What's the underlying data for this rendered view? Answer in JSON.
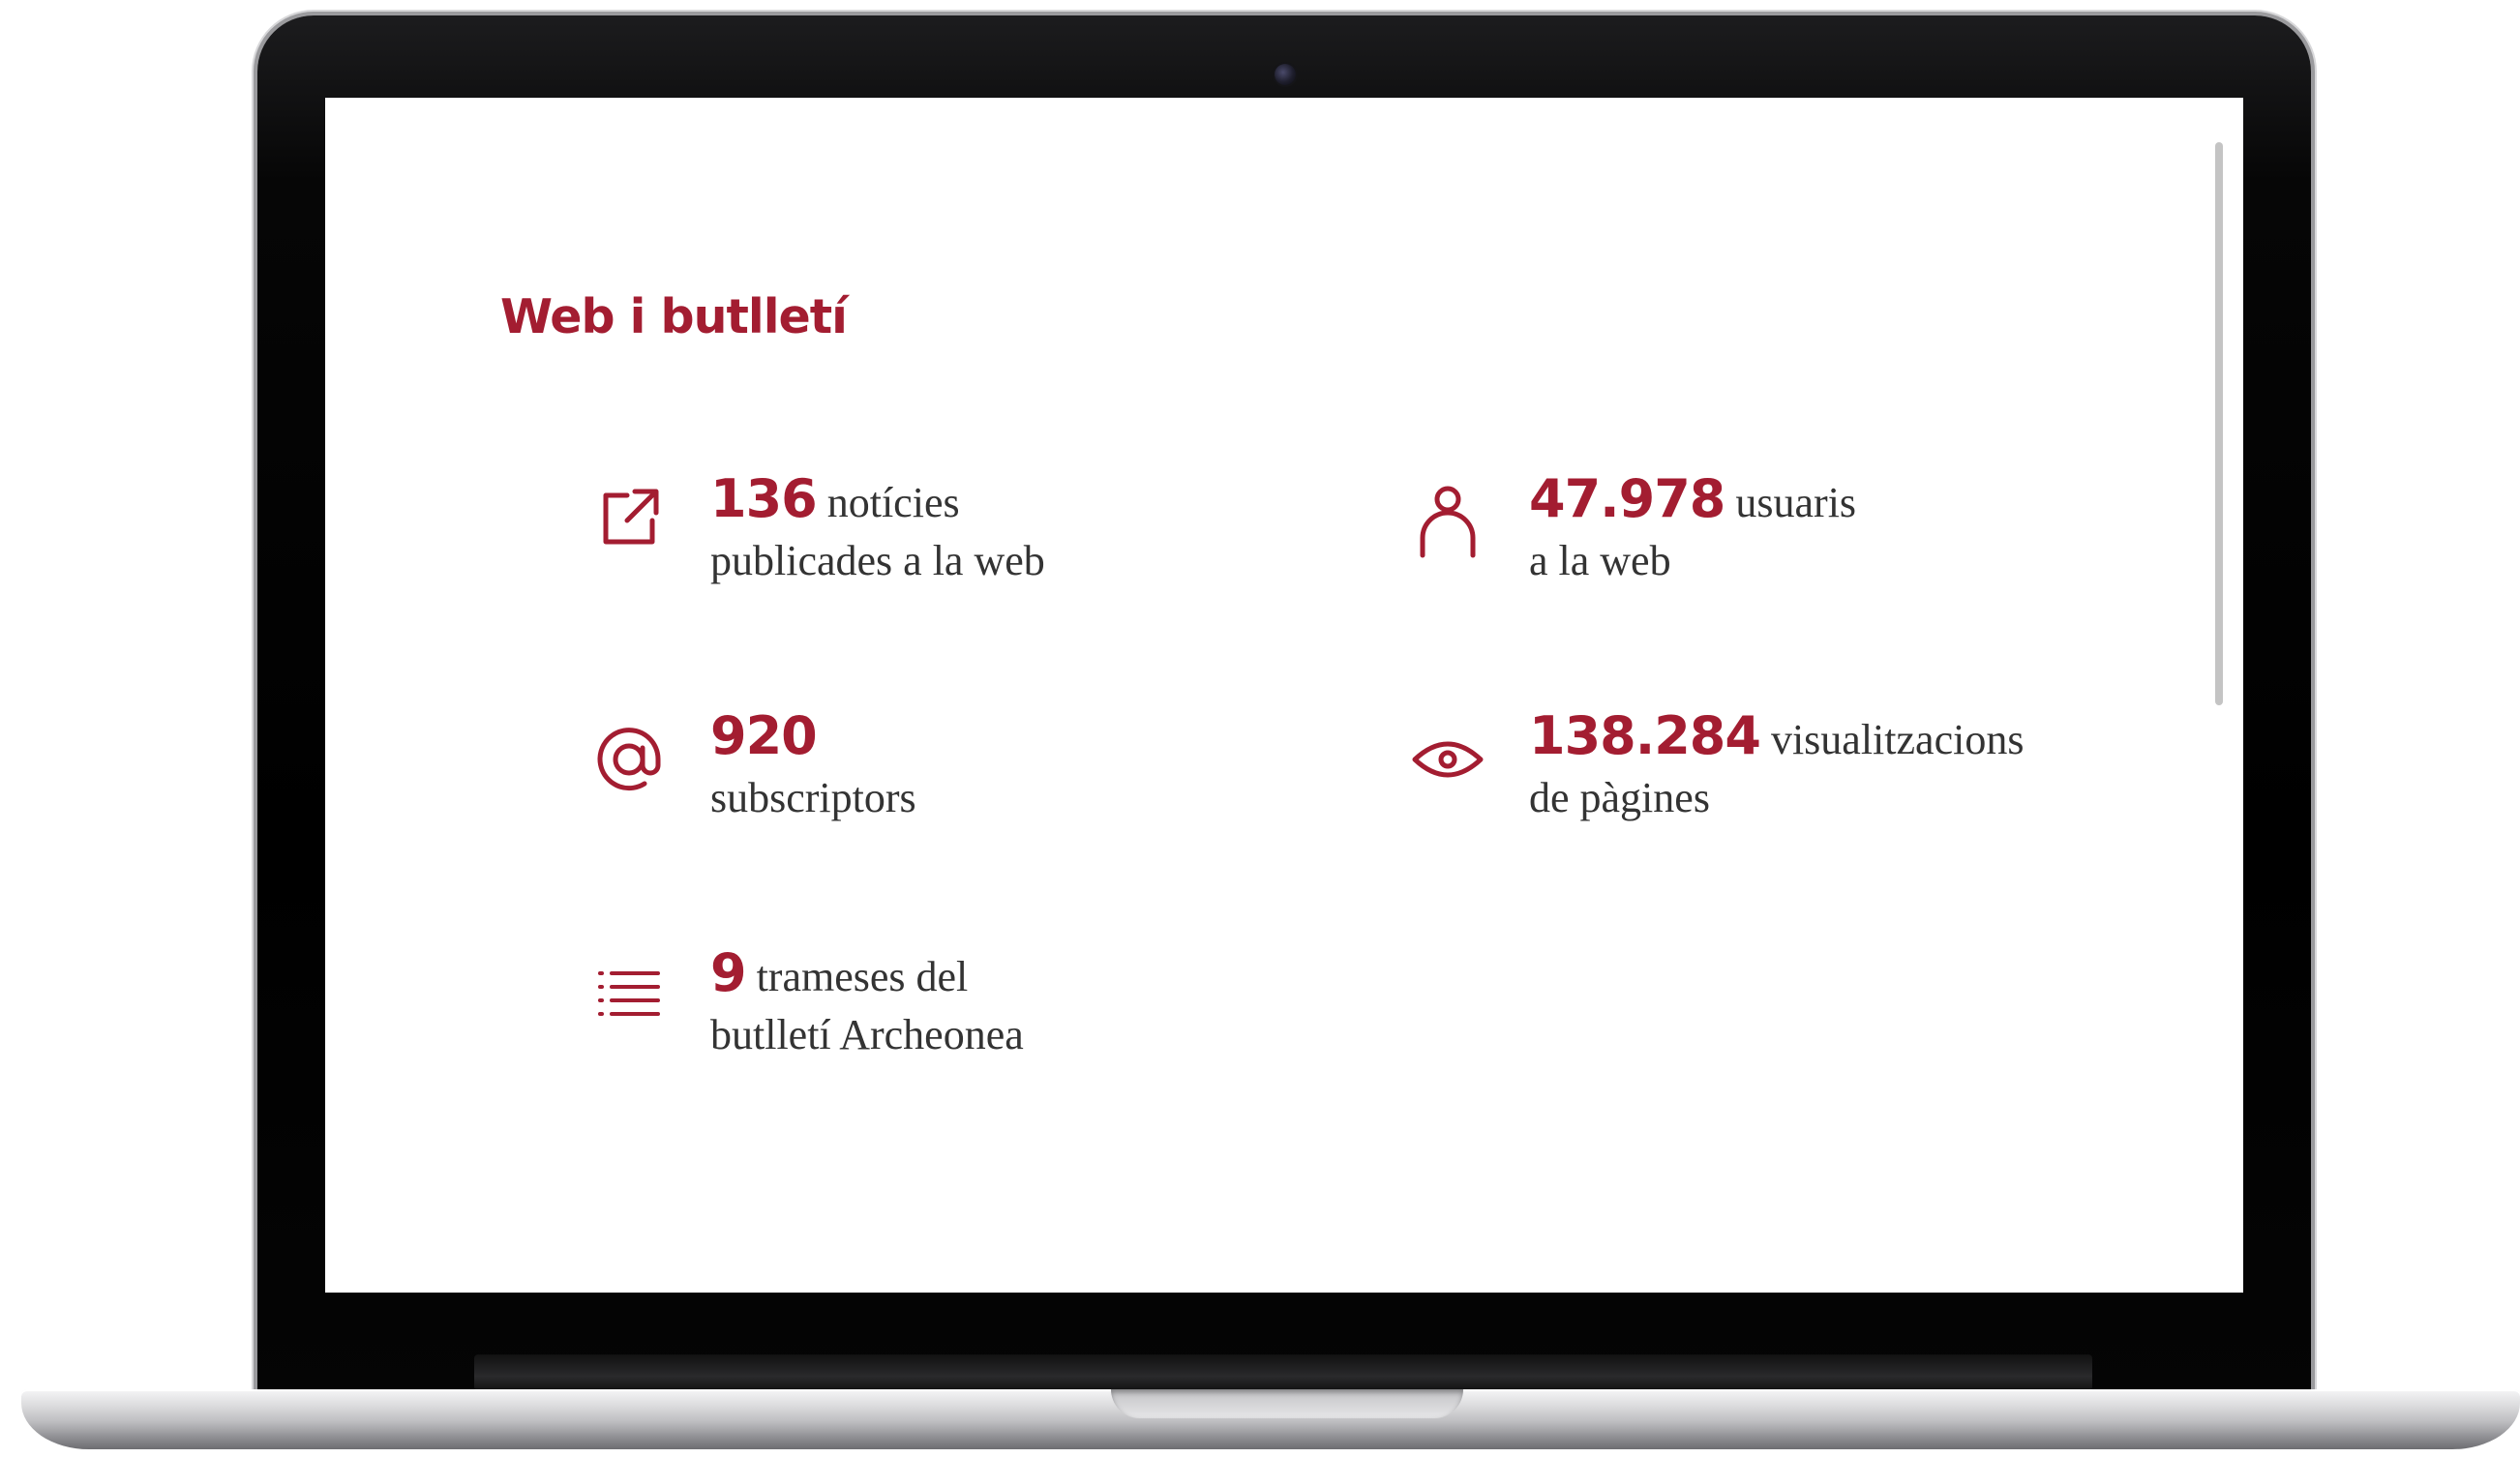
{
  "colors": {
    "accent": "#a31d31",
    "text": "#333333",
    "screen_bg": "#ffffff",
    "bezel": "#000000"
  },
  "section": {
    "title": "Web i butlletí"
  },
  "stats": [
    {
      "icon": "external-link-icon",
      "number": "136",
      "label_line1": "notícies",
      "label_line2": "publicades a la web"
    },
    {
      "icon": "user-icon",
      "number": "47.978",
      "label_line1": "usuaris",
      "label_line2": "a la web"
    },
    {
      "icon": "at-sign-icon",
      "number": "920",
      "label_line1": "",
      "label_line2": "subscriptors"
    },
    {
      "icon": "eye-icon",
      "number": "138.284",
      "label_line1": "visualitzacions",
      "label_line2": "de pàgines"
    },
    {
      "icon": "list-icon",
      "number": "9",
      "label_line1": "trameses del",
      "label_line2": "butlletí Archeonea"
    }
  ]
}
